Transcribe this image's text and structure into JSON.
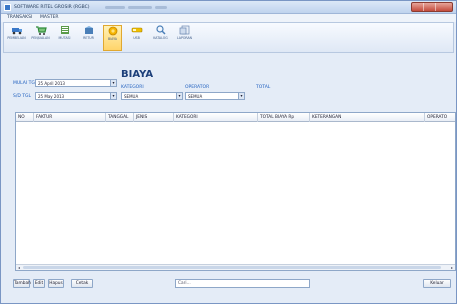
{
  "window": {
    "title": "SOFTWARE RITEL GROSIR (RGBC)"
  },
  "menu": [
    {
      "label": "TRANSAKSI"
    },
    {
      "label": "MASTER"
    }
  ],
  "ribbon": [
    {
      "label": "PEMBELIAN",
      "icon": "truck-icon"
    },
    {
      "label": "PENJUALAN",
      "icon": "cart-icon"
    },
    {
      "label": "MUTASI",
      "icon": "book-icon"
    },
    {
      "label": "RETUR",
      "icon": "box-icon"
    },
    {
      "label": "BIAYA",
      "icon": "coin-icon",
      "active": true
    },
    {
      "label": "USB",
      "icon": "usb-icon"
    },
    {
      "label": "KATALOG",
      "icon": "magnifier-icon"
    },
    {
      "label": "LAPORAN",
      "icon": "report-icon"
    }
  ],
  "filters": {
    "from_label": "MULAI TGL",
    "from_value": "25 April 2013",
    "to_label": "S/D TGL",
    "to_value": "25 May 2013",
    "heading": "BIAYA",
    "kategori_label": "KATEGORI",
    "kategori_value": "SEMUA",
    "operator_label": "OPERATOR",
    "operator_value": "SEMUA",
    "total_label": "TOTAL"
  },
  "table": {
    "columns": [
      "NO",
      "FAKTUR",
      "TANGGAL",
      "JENIS",
      "KATEGORI",
      "TOTAL BIAYA Rp",
      "KETERANGAN",
      "OPERATO"
    ],
    "rows": []
  },
  "bottom": {
    "tambah": "Tambah",
    "edit": "Edit",
    "hapus": "Hapus",
    "cetak": "Cetak",
    "search_placeholder": "Cari...",
    "keluar": "Keluar"
  },
  "colors": {
    "accent": "#1f5fbf",
    "active_tab": "#ffd46a",
    "titlebar": "#bfd3ee"
  }
}
